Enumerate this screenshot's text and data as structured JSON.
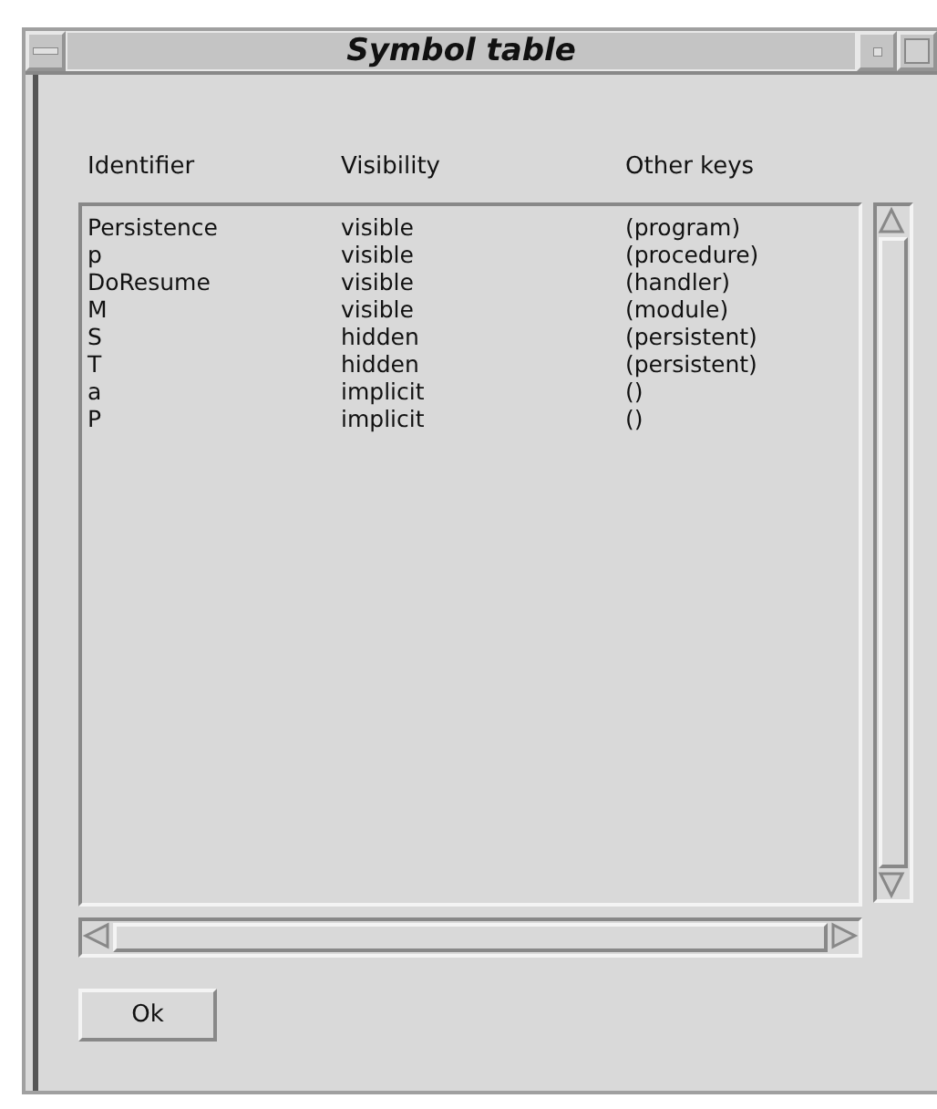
{
  "window": {
    "title": "Symbol table"
  },
  "table": {
    "columns": [
      "Identifier",
      "Visibility",
      "Other keys"
    ],
    "rows": [
      [
        "Persistence",
        "visible",
        "(program)"
      ],
      [
        "p",
        "visible",
        "(procedure)"
      ],
      [
        "DoResume",
        "visible",
        "(handler)"
      ],
      [
        "M",
        "visible",
        "(module)"
      ],
      [
        "S",
        "hidden",
        "(persistent)"
      ],
      [
        "T",
        "hidden",
        "(persistent)"
      ],
      [
        "a",
        "implicit",
        "()"
      ],
      [
        "P",
        "implicit",
        "()"
      ]
    ]
  },
  "buttons": [
    "Ok"
  ]
}
